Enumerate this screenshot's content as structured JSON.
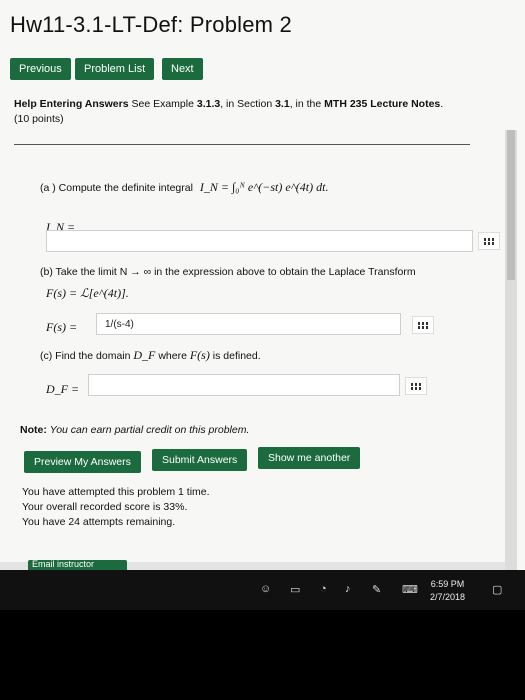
{
  "title": "Hw11-3.1-LT-Def: Problem 2",
  "nav": {
    "previous": "Previous",
    "problem_list": "Problem List",
    "next": "Next"
  },
  "help": {
    "link": "Help Entering Answers",
    "text_a": "See Example ",
    "example": "3.1.3",
    "text_b": ", in Section ",
    "section": "3.1",
    "text_c": ", in the ",
    "course": "MTH 235 Lecture Notes",
    "text_d": ".",
    "points": "(10 points)"
  },
  "part_a": {
    "prompt": "(a ) Compute the definite integral",
    "formula": "I_N = ∫₀ᴺ e^(−st) e^(4t) dt.",
    "label": "I_N =",
    "value": ""
  },
  "part_b": {
    "prompt": "(b) Take the limit N → ∞ in the expression above to obtain the Laplace Transform",
    "formula": "F(s) = ℒ[e^(4t)].",
    "label": "F(s) =",
    "value": "1/(s-4)"
  },
  "part_c": {
    "prompt_a": "(c) Find the domain",
    "prompt_var": "D_F",
    "prompt_b": "where",
    "prompt_f": "F(s)",
    "prompt_c": "is defined.",
    "label": "D_F =",
    "value": ""
  },
  "note": {
    "label": "Note:",
    "text": "You can earn partial credit on this problem."
  },
  "buttons": {
    "preview": "Preview My Answers",
    "submit": "Submit Answers",
    "another": "Show me another"
  },
  "status": [
    "You have attempted this problem 1 time.",
    "Your overall recorded score is 33%.",
    "You have 24 attempts remaining."
  ],
  "email_button": "Email instructor",
  "clock": {
    "time": "6:59 PM",
    "date": "2/7/2018"
  },
  "colors": {
    "button": "#1b6b3f",
    "background": "#f7f7f5"
  }
}
